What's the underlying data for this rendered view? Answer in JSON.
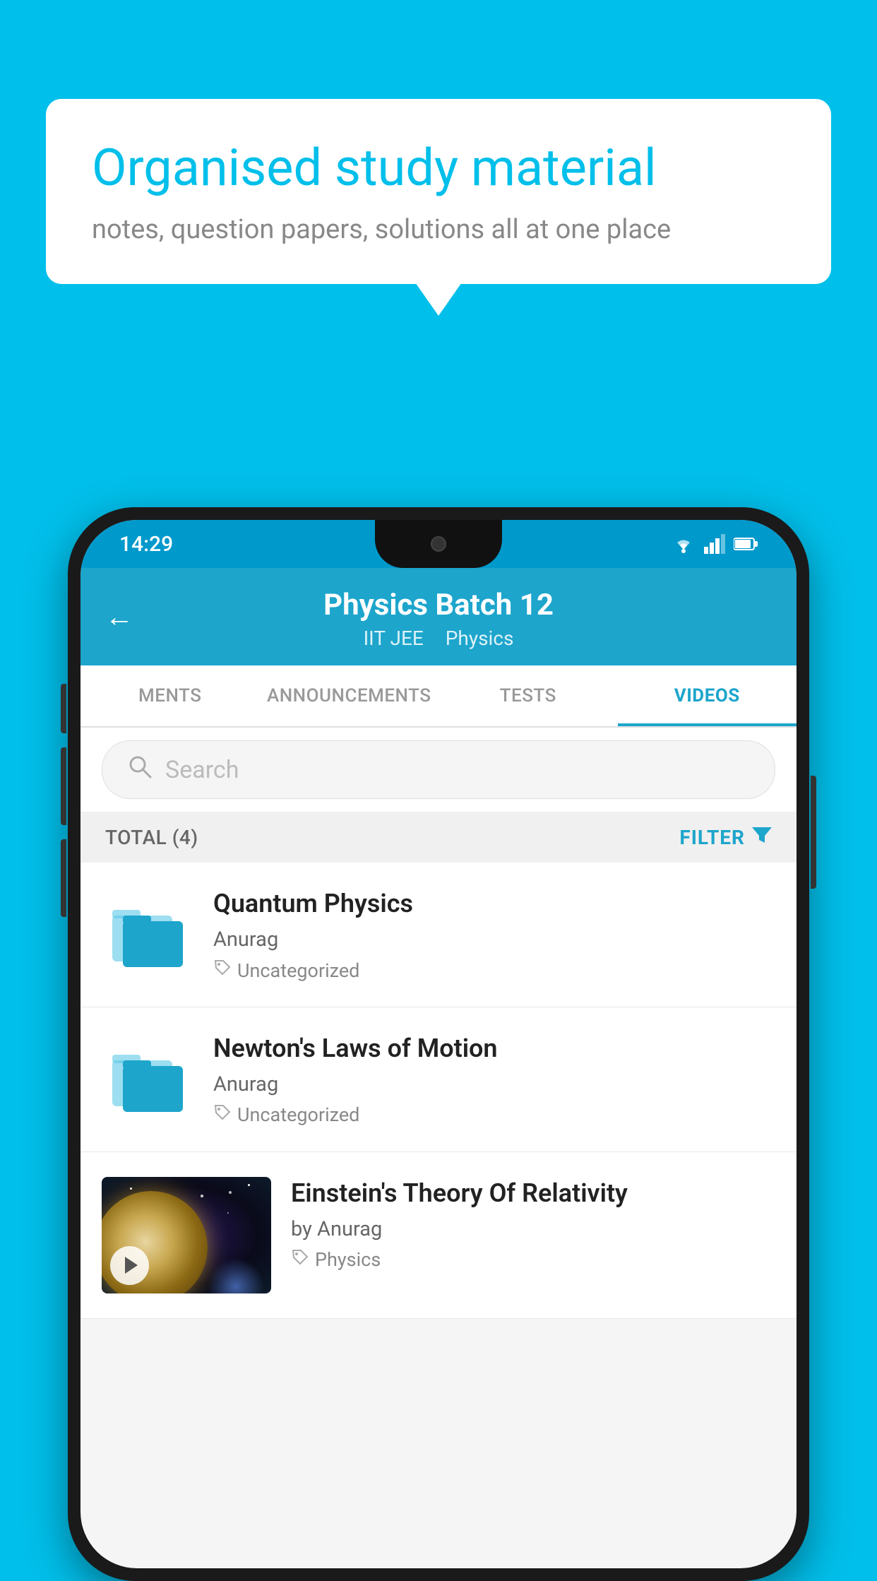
{
  "page": {
    "background_color": "#00BFEA"
  },
  "speech_bubble": {
    "title": "Organised study material",
    "subtitle": "notes, question papers, solutions all at one place"
  },
  "status_bar": {
    "time": "14:29",
    "icons": [
      "wifi",
      "signal",
      "battery"
    ]
  },
  "app_header": {
    "title": "Physics Batch 12",
    "subtitle_tag1": "IIT JEE",
    "subtitle_tag2": "Physics",
    "back_label": "←"
  },
  "tabs": [
    {
      "label": "MENTS",
      "active": false
    },
    {
      "label": "ANNOUNCEMENTS",
      "active": false
    },
    {
      "label": "TESTS",
      "active": false
    },
    {
      "label": "VIDEOS",
      "active": true
    }
  ],
  "search": {
    "placeholder": "Search"
  },
  "filter_row": {
    "total_label": "TOTAL (4)",
    "filter_label": "FILTER"
  },
  "videos": [
    {
      "title": "Quantum Physics",
      "author": "Anurag",
      "tag": "Uncategorized",
      "type": "folder"
    },
    {
      "title": "Newton's Laws of Motion",
      "author": "Anurag",
      "tag": "Uncategorized",
      "type": "folder"
    },
    {
      "title": "Einstein's Theory Of Relativity",
      "author": "by Anurag",
      "tag": "Physics",
      "type": "video"
    }
  ]
}
